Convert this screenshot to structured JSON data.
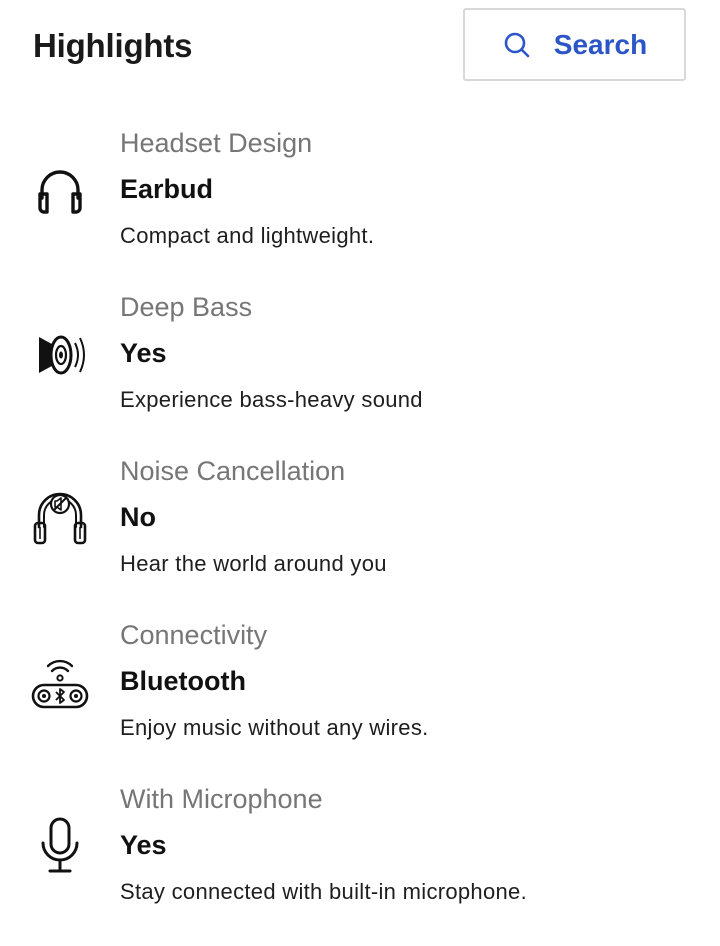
{
  "header": {
    "title": "Highlights",
    "search_label": "Search",
    "search_icon": "search-icon",
    "accent_color": "#2c56c8"
  },
  "highlights": [
    {
      "name": "Headset Design",
      "value": "Earbud",
      "description": "Compact and lightweight.",
      "icon": "headphones-icon"
    },
    {
      "name": "Deep Bass",
      "value": "Yes",
      "description": "Experience bass-heavy sound",
      "icon": "speaker-icon"
    },
    {
      "name": "Noise Cancellation",
      "value": "No",
      "description": "Hear the world around you",
      "icon": "noise-cancellation-icon"
    },
    {
      "name": "Connectivity",
      "value": "Bluetooth",
      "description": "Enjoy music without any wires.",
      "icon": "bluetooth-device-icon"
    },
    {
      "name": "With Microphone",
      "value": "Yes",
      "description": "Stay connected with built-in microphone.",
      "icon": "microphone-icon"
    }
  ]
}
